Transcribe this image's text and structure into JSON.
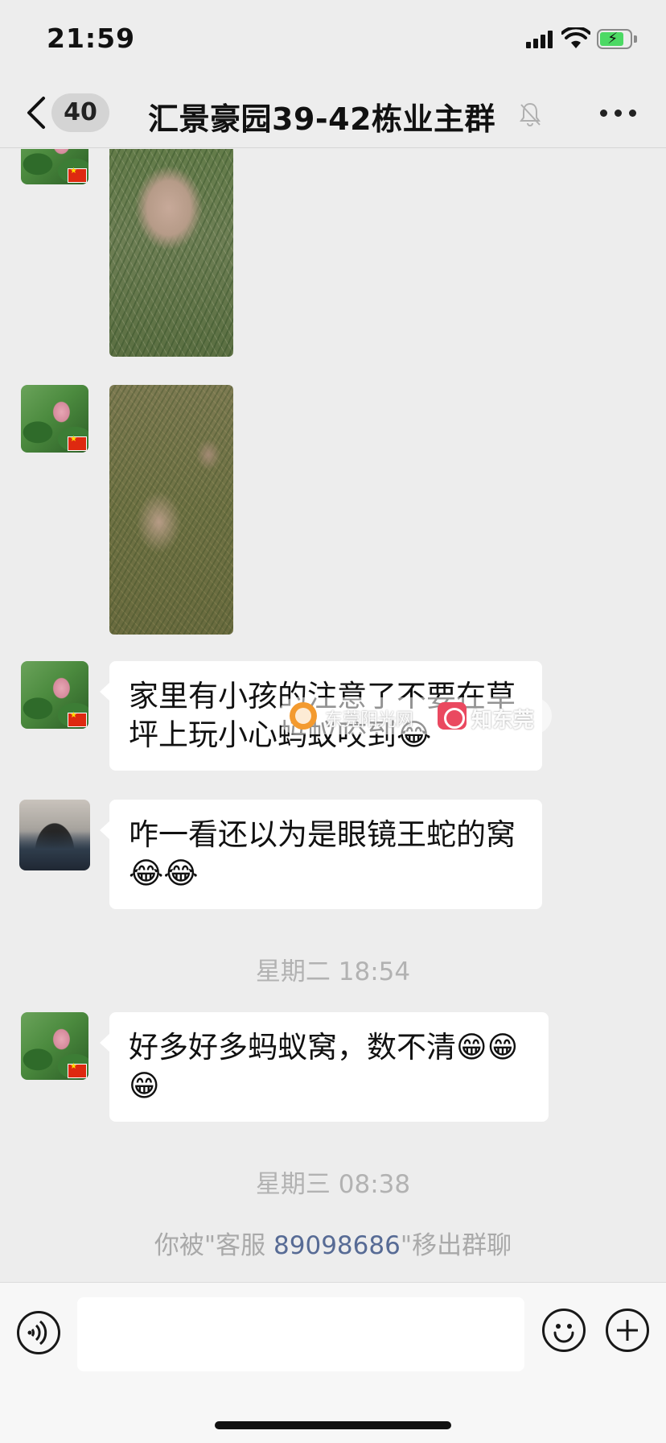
{
  "status_bar": {
    "time": "21:59",
    "battery_level": 0.8,
    "battery_charging": true
  },
  "nav": {
    "back_icon": "chevron-left-icon",
    "unread_badge": "40",
    "title": "汇景豪园39-42栋业主群",
    "mute_icon": "bell-muted-icon",
    "more_icon": "more-dots-icon"
  },
  "messages": [
    {
      "type": "image",
      "sender": "lotus-avatar",
      "image_desc": "grass"
    },
    {
      "type": "image",
      "sender": "lotus-avatar",
      "image_desc": "grass"
    },
    {
      "type": "text",
      "sender": "lotus-avatar",
      "text": "家里有小孩的注意了不要在草坪上玩小心蚂蚁咬到😂"
    },
    {
      "type": "text",
      "sender": "mountain-avatar",
      "text": "咋一看还以为是眼镜王蛇的窝😂😂"
    },
    {
      "type": "timestamp",
      "text": "星期二 18:54"
    },
    {
      "type": "text",
      "sender": "lotus-avatar",
      "text": "好多好多蚂蚁窝，数不清😁😁😁"
    },
    {
      "type": "timestamp",
      "text": "星期三 08:38"
    }
  ],
  "system_notice": {
    "prefix": "你被\"客服 ",
    "id": "89098686",
    "suffix": "\"移出群聊"
  },
  "watermark": {
    "brand1": "东莞阳光网",
    "brand2": "知东莞"
  },
  "input_bar": {
    "voice_icon": "voice-icon",
    "input_placeholder": "",
    "emoji_icon": "emoji-icon",
    "plus_icon": "plus-icon"
  },
  "colors": {
    "background": "#ededed",
    "bubble": "#ffffff",
    "link": "#576b95",
    "timestamp": "#b2b2b2",
    "battery": "#4cd964"
  }
}
